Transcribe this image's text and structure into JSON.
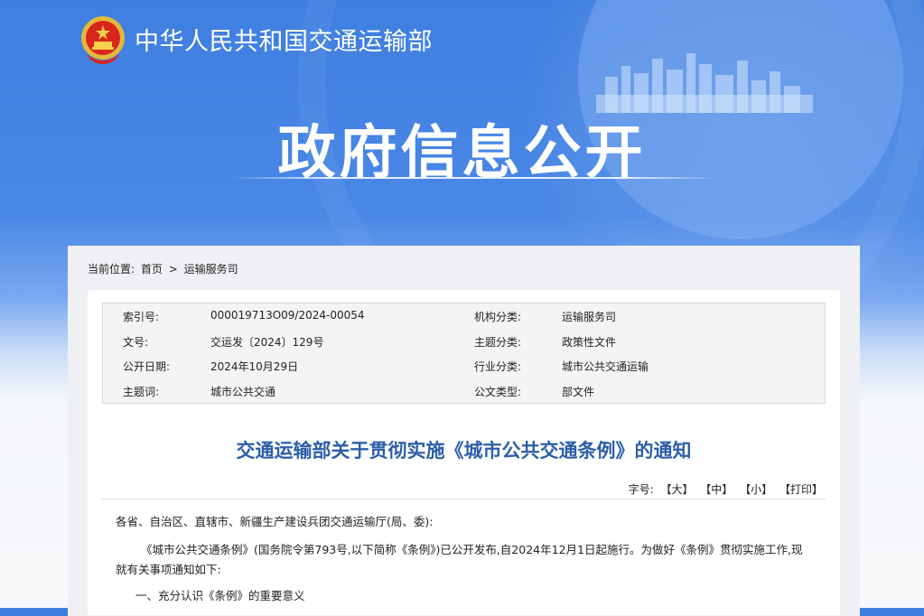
{
  "header": {
    "site_name": "中华人民共和国交通运输部",
    "hero_title": "政府信息公开"
  },
  "breadcrumb": {
    "label": "当前位置:",
    "home": "首页",
    "separator": ">",
    "current": "运输服务司"
  },
  "meta": {
    "rows": [
      {
        "k1": "索引号:",
        "v1": "000019713O09/2024-00054",
        "k2": "机构分类:",
        "v2": "运输服务司"
      },
      {
        "k1": "文号:",
        "v1": "交运发〔2024〕129号",
        "k2": "主题分类:",
        "v2": "政策性文件"
      },
      {
        "k1": "公开日期:",
        "v1": "2024年10月29日",
        "k2": "行业分类:",
        "v2": "城市公共交通运输"
      },
      {
        "k1": "主题词:",
        "v1": "城市公共交通",
        "k2": "公文类型:",
        "v2": "部文件"
      }
    ]
  },
  "article": {
    "title": "交通运输部关于贯彻实施《城市公共交通条例》的通知",
    "font_label": "字号:",
    "font_large": "【大】",
    "font_medium": "【中】",
    "font_small": "【小】",
    "print": "【打印】",
    "salutation": "各省、自治区、直辖市、新疆生产建设兵团交通运输厅(局、委):",
    "para1_line1": "《城市公共交通条例》(国务院令第793号,以下简称《条例》)已公开发布,自2024年12月1日起施行。为做好《条例》贯彻实施工作,现",
    "para1_line2": "就有关事项通知如下:",
    "section1": "一、充分认识《条例》的重要意义"
  },
  "colors": {
    "hero_blue": "#4a88e6",
    "title_blue": "#2b5ea8"
  }
}
